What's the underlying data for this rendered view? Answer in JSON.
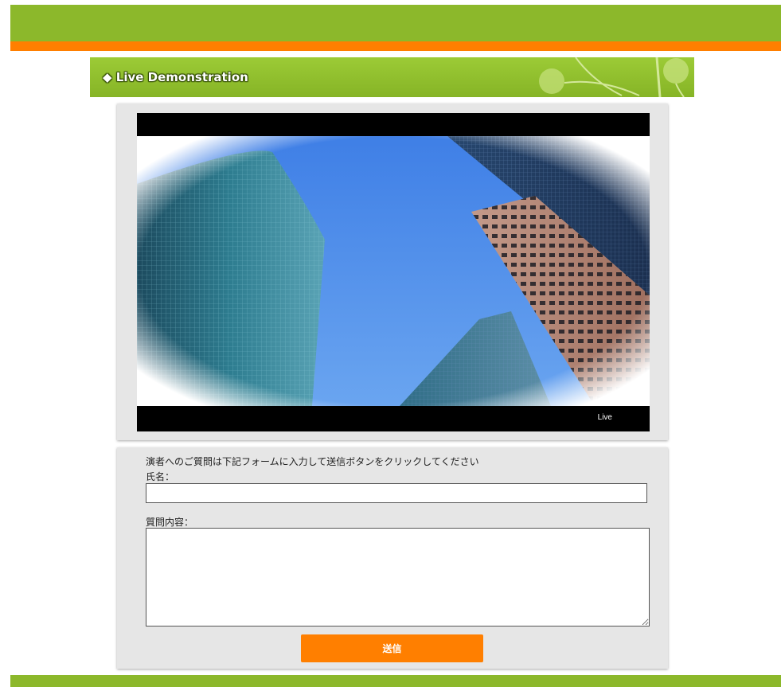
{
  "header": {
    "title": "Live Demonstration",
    "title_icon": "diamond-icon",
    "colors": {
      "green": "#8cb82b",
      "orange": "#ff7f00"
    }
  },
  "video": {
    "status_label": "Live"
  },
  "form": {
    "instructions": "演者へのご質問は下記フォームに入力して送信ボタンをクリックしてください",
    "name_label": "氏名：",
    "name_value": "",
    "question_label": "質問内容：",
    "question_value": "",
    "submit_label": "送信"
  }
}
